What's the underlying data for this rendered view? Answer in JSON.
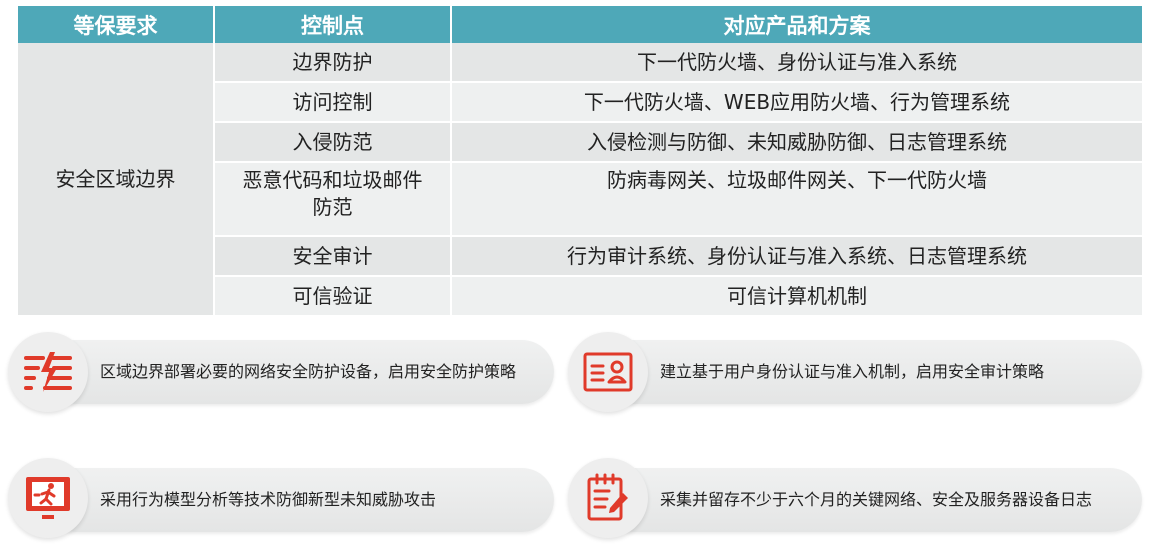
{
  "table": {
    "headers": [
      "等保要求",
      "控制点",
      "对应产品和方案"
    ],
    "zone": "安全区域边界",
    "rows": [
      {
        "control": "边界防护",
        "products": "下一代防火墙、身份认证与准入系统"
      },
      {
        "control": "访问控制",
        "products": "下一代防火墙、WEB应用防火墙、行为管理系统"
      },
      {
        "control": "入侵防范",
        "products": "入侵检测与防御、未知威胁防御、日志管理系统"
      },
      {
        "control": "恶意代码和垃圾邮件防范",
        "products": "防病毒网关、垃圾邮件网关、下一代防火墙"
      },
      {
        "control": "安全审计",
        "products": "行为审计系统、身份认证与准入系统、日志管理系统"
      },
      {
        "control": "可信验证",
        "products": "可信计算机机制"
      }
    ]
  },
  "callouts": [
    {
      "icon": "firewall-icon",
      "text": "区域边界部署必要的网络安全防护设备，启用安全防护策略"
    },
    {
      "icon": "id-card-icon",
      "text": "建立基于用户身份认证与准入机制，启用安全审计策略"
    },
    {
      "icon": "exit-run-icon",
      "text": "采用行为模型分析等技术防御新型未知威胁攻击"
    },
    {
      "icon": "log-edit-icon",
      "text": "采集并留存不少于六个月的关键网络、安全及服务器设备日志"
    }
  ],
  "colors": {
    "header": "#4ea8b8",
    "icon": "#e03a2a"
  }
}
